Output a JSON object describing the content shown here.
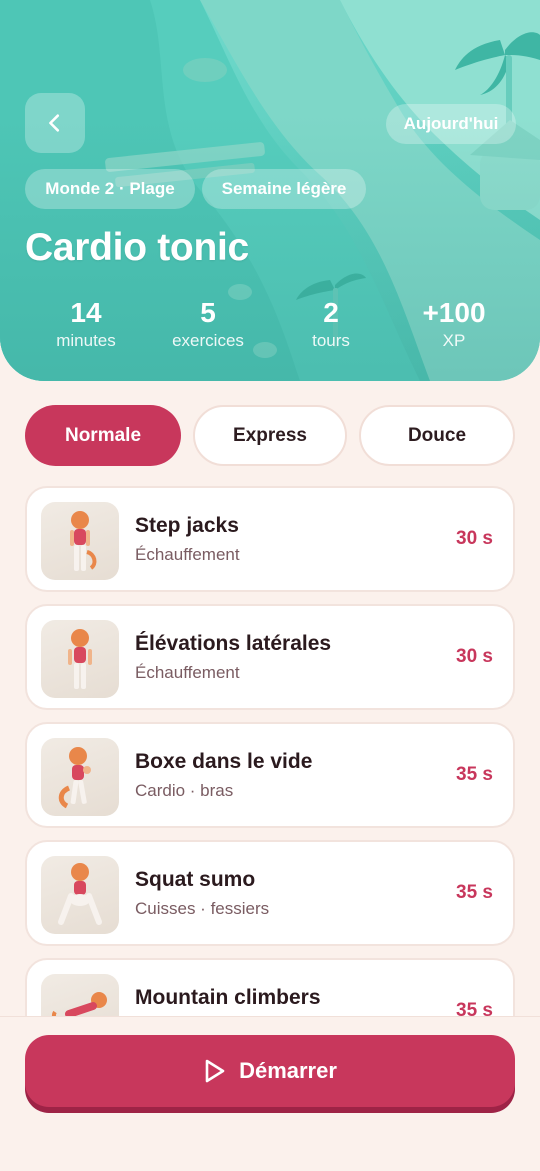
{
  "header": {
    "back_icon": "chevron-left-icon",
    "today_label": "Aujourd'hui",
    "tags": [
      "Monde 2 · Plage",
      "Semaine légère"
    ],
    "title": "Cardio tonic",
    "stats": [
      {
        "value": "14",
        "label": "minutes"
      },
      {
        "value": "5",
        "label": "exercices"
      },
      {
        "value": "2",
        "label": "tours"
      },
      {
        "value": "+100",
        "label": "XP"
      }
    ]
  },
  "modes": {
    "selected": "Normale",
    "options": [
      "Normale",
      "Express",
      "Douce"
    ]
  },
  "exercises": [
    {
      "name": "Step jacks",
      "category": "Échauffement",
      "duration": "30 s"
    },
    {
      "name": "Élévations latérales",
      "category": "Échauffement",
      "duration": "30 s"
    },
    {
      "name": "Boxe dans le vide",
      "category": "Cardio · bras",
      "duration": "35 s"
    },
    {
      "name": "Squat sumo",
      "category": "Cuisses · fessiers",
      "duration": "35 s"
    },
    {
      "name": "Mountain climbers",
      "category": "",
      "duration": "35 s"
    }
  ],
  "start_button": {
    "label": "Démarrer",
    "icon": "play-icon"
  },
  "colors": {
    "accent": "#c8375c",
    "hero_teal": "#5fd0c1",
    "background": "#fbf1ec"
  }
}
